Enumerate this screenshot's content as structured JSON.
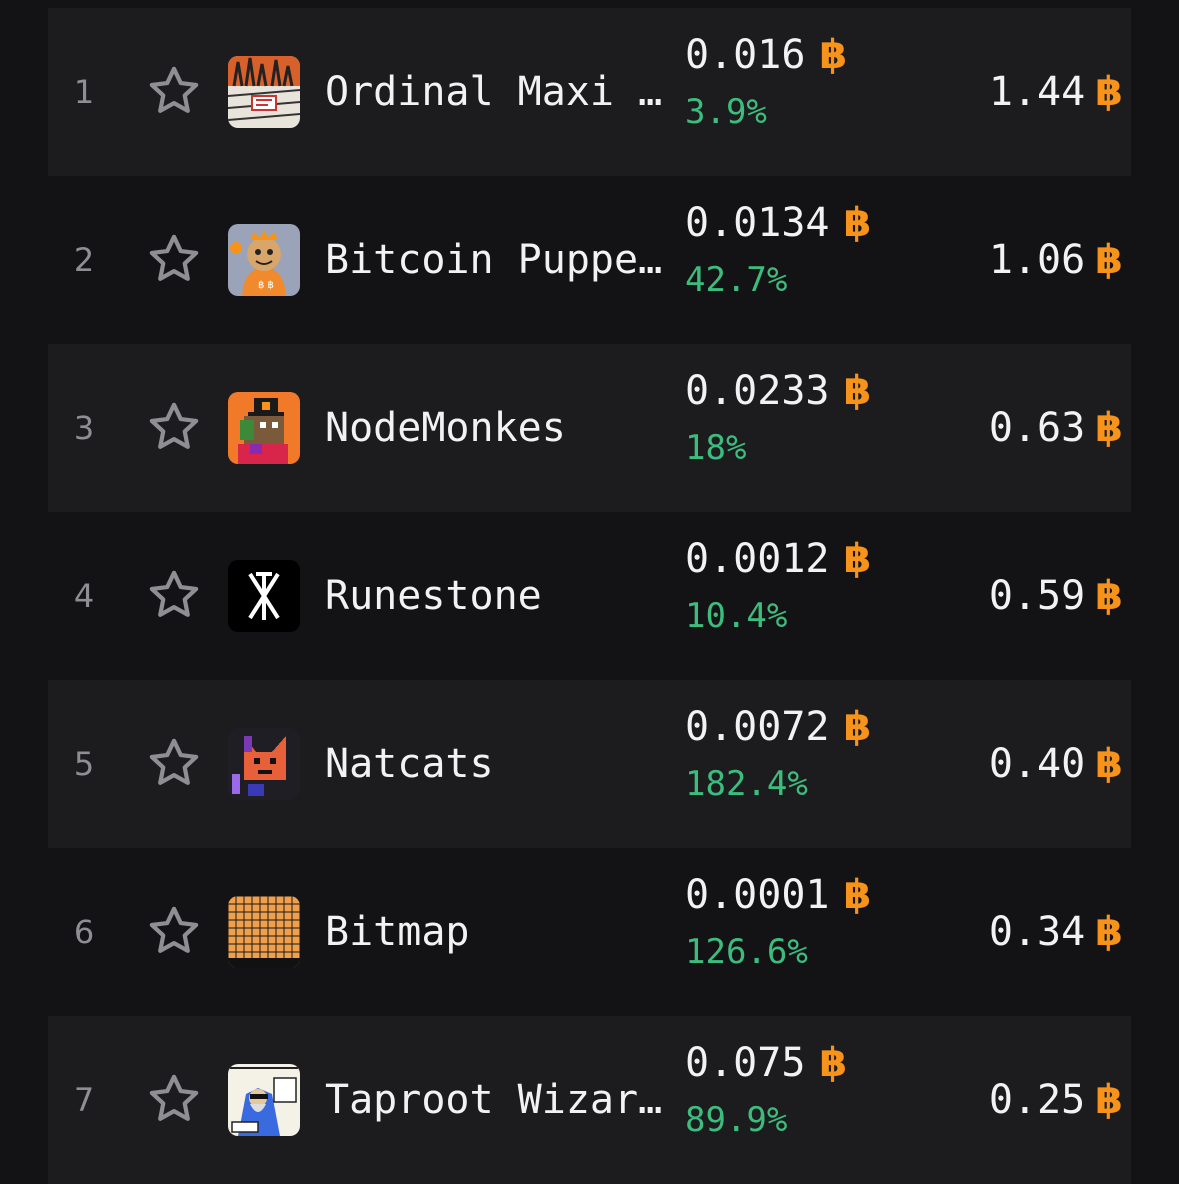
{
  "currency_symbol": "฿",
  "colors": {
    "accent": "#f7931a",
    "positive": "#3dbd7d",
    "text": "#f2f2f2",
    "muted": "#8e8e93"
  },
  "collections": [
    {
      "rank": "1",
      "name": "Ordinal Maxi …",
      "floor_price": "0.016",
      "change": "3.9%",
      "volume": "1.44",
      "icon": "ordinal-maxi-thumbnail"
    },
    {
      "rank": "2",
      "name": "Bitcoin Puppe…",
      "floor_price": "0.0134",
      "change": "42.7%",
      "volume": "1.06",
      "icon": "bitcoin-puppets-thumbnail"
    },
    {
      "rank": "3",
      "name": "NodeMonkes",
      "floor_price": "0.0233",
      "change": "18%",
      "volume": "0.63",
      "icon": "nodemonkes-thumbnail"
    },
    {
      "rank": "4",
      "name": "Runestone",
      "floor_price": "0.0012",
      "change": "10.4%",
      "volume": "0.59",
      "icon": "runestone-thumbnail"
    },
    {
      "rank": "5",
      "name": "Natcats",
      "floor_price": "0.0072",
      "change": "182.4%",
      "volume": "0.40",
      "icon": "natcats-thumbnail"
    },
    {
      "rank": "6",
      "name": "Bitmap",
      "floor_price": "0.0001",
      "change": "126.6%",
      "volume": "0.34",
      "icon": "bitmap-thumbnail"
    },
    {
      "rank": "7",
      "name": "Taproot Wizar…",
      "floor_price": "0.075",
      "change": "89.9%",
      "volume": "0.25",
      "icon": "taproot-wizards-thumbnail"
    }
  ]
}
